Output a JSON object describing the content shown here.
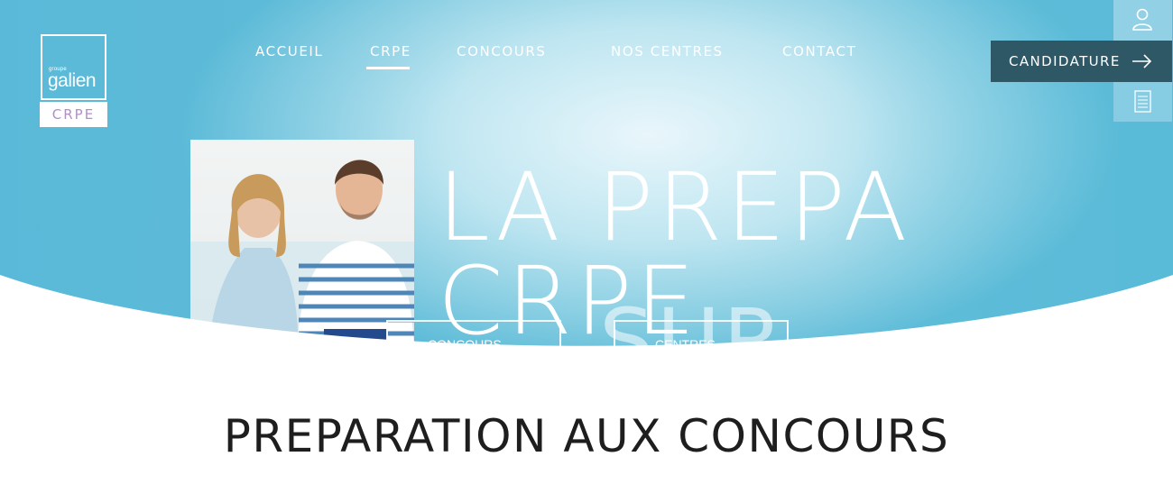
{
  "brand": {
    "logo_small": "groupe",
    "logo_main": "galien",
    "logo_tag": "CRPE"
  },
  "nav": {
    "items": [
      "ACCUEIL",
      "CRPE",
      "CONCOURS",
      "NOS CENTRES",
      "CONTACT"
    ],
    "active": "CRPE"
  },
  "header": {
    "candidature_label": "CANDIDATURE",
    "icons": [
      "user-icon",
      "arrow-right-icon",
      "document-icon"
    ]
  },
  "hero": {
    "headline": "LA PREPA CRPE",
    "headline_2": "SUR MESURE",
    "buttons": [
      "CONCOURS",
      "CENTRES"
    ]
  },
  "main": {
    "section_title": "PREPARATION AUX CONCOURS"
  },
  "colors": {
    "hero_light": "#e9f6fb",
    "hero_dark": "#5fbcd8",
    "candidature_bg": "#2e5866",
    "logo_tag_text": "#b08fc6",
    "title_text": "#1e1e1e"
  }
}
